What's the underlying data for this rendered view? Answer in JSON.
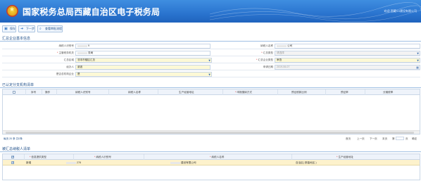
{
  "header": {
    "title": "国家税务总局西藏自治区电子税务局",
    "welcome": "欢迎 西藏XX建设有限公司"
  },
  "toolbar": {
    "save": "保存",
    "next": "下一步",
    "query": "查看审批流程"
  },
  "section1": {
    "title": "汇总企业基本信息",
    "fields": {
      "taxpayer_id_label": "纳税人识别号",
      "taxpayer_id_value": "9",
      "taxpayer_name_label": "纳税人名称",
      "taxpayer_name_value": "公司",
      "tax_authority_label": "主管税务机关",
      "tax_authority_value": "务局",
      "summary_type_label": "汇总类型",
      "summary_type_value": "请选择",
      "summary_region_label": "汇总区域",
      "summary_region_value": "非本市辖区汇总",
      "summary_company_type_label": "汇总企业类型",
      "summary_company_type_value": "审查",
      "agent_label": "经办人",
      "agent_value": "谢波",
      "apply_date_label": "申请日期",
      "apply_date_value": "2019-06-07",
      "is_parent_label": "是否总机构企业",
      "is_parent_value": "是"
    }
  },
  "section2": {
    "title": "已认定分支机构清单",
    "columns": [
      "序号",
      "操作",
      "纳税人识别号",
      "纳税人名称",
      "生产经营地址",
      "申报缴纳方式",
      "预征税款比例",
      "预征率",
      "分摊税率"
    ],
    "pager": {
      "left": "每页 20 条 共0条",
      "first": "首页",
      "prev": "上一页",
      "next": "下一页",
      "last": "末页",
      "page_label": "第",
      "page_suffix": "页",
      "go": "确定"
    }
  },
  "section3": {
    "title": "被汇总纳税人清单",
    "columns": [
      "信息提供类型",
      "纳税人识别号",
      "纳税人名称",
      "生产经营地址"
    ],
    "row": {
      "type": "新增",
      "taxpayer_id": "278",
      "taxpayer_name": "建设有限公司",
      "address": "自治区( 那曲地区 )"
    }
  }
}
